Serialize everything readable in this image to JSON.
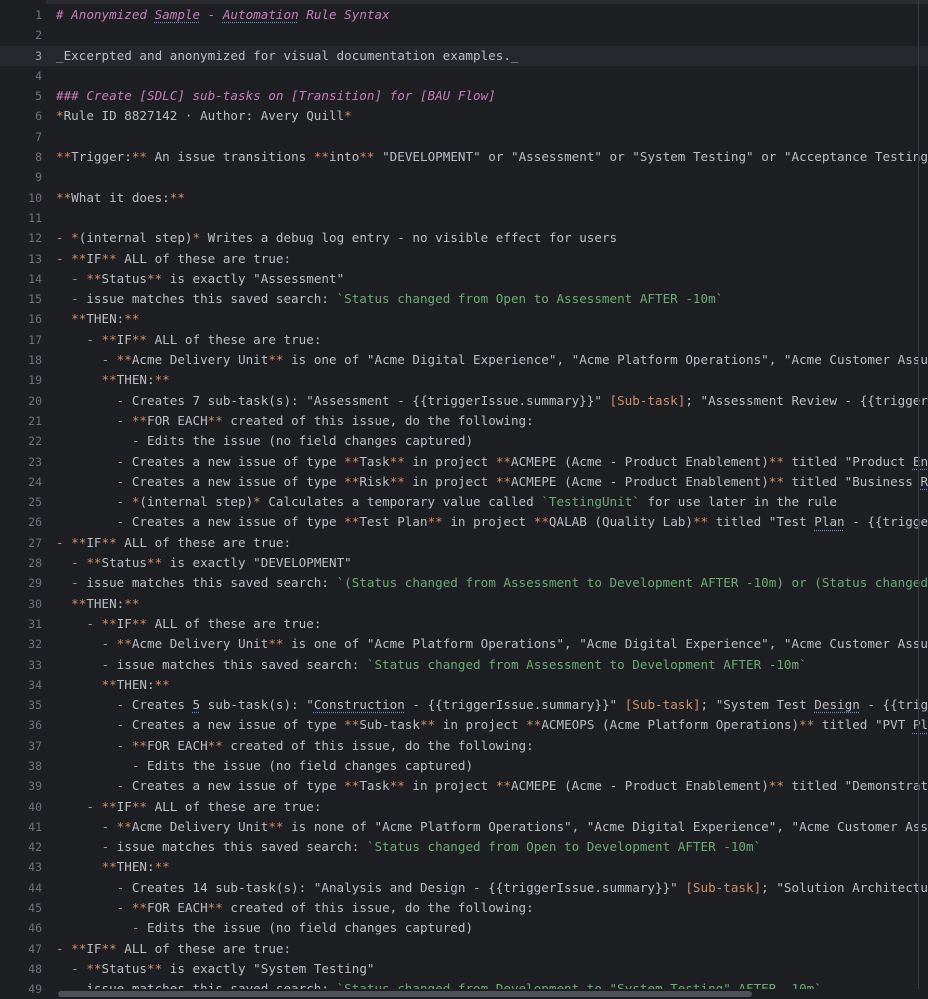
{
  "lines": [
    {
      "n": "1",
      "parts": [
        {
          "t": "# Anonymized ",
          "c": "h"
        },
        {
          "t": "Sample",
          "c": "h typo"
        },
        {
          "t": " - ",
          "c": "h"
        },
        {
          "t": "Automation",
          "c": "h typo"
        },
        {
          "t": " Rule Syntax",
          "c": "h"
        }
      ]
    },
    {
      "n": "2",
      "parts": []
    },
    {
      "n": "3",
      "current": true,
      "parts": [
        {
          "t": "_Excerpted and anonymized for visual documentation examples._"
        }
      ]
    },
    {
      "n": "4",
      "parts": []
    },
    {
      "n": "5",
      "parts": [
        {
          "t": "### Create [SDLC] sub-tasks on [Transition] for [BAU Flow]",
          "c": "h"
        }
      ]
    },
    {
      "n": "6",
      "parts": [
        {
          "t": "*",
          "c": "mk"
        },
        {
          "t": "Rule ID 8827142 · Author: Avery Quill"
        },
        {
          "t": "*",
          "c": "mk"
        }
      ]
    },
    {
      "n": "7",
      "parts": []
    },
    {
      "n": "8",
      "parts": [
        {
          "t": "**",
          "c": "mk"
        },
        {
          "t": "Trigger:"
        },
        {
          "t": "**",
          "c": "mk"
        },
        {
          "t": " An issue transitions "
        },
        {
          "t": "**",
          "c": "mk"
        },
        {
          "t": "into"
        },
        {
          "t": "**",
          "c": "mk"
        },
        {
          "t": " \"DEVELOPMENT\" or \"Assessment\" or \"System Testing\" or \"Acceptance Testing\" or \"R"
        }
      ]
    },
    {
      "n": "9",
      "parts": []
    },
    {
      "n": "10",
      "parts": [
        {
          "t": "**",
          "c": "mk"
        },
        {
          "t": "What it does:"
        },
        {
          "t": "**",
          "c": "mk"
        }
      ]
    },
    {
      "n": "11",
      "parts": []
    },
    {
      "n": "12",
      "parts": [
        {
          "t": "- ",
          "c": "mk"
        },
        {
          "t": "*",
          "c": "mk"
        },
        {
          "t": "(internal step)"
        },
        {
          "t": "*",
          "c": "mk"
        },
        {
          "t": " Writes a debug log entry - no visible effect for users"
        }
      ]
    },
    {
      "n": "13",
      "parts": [
        {
          "t": "- ",
          "c": "mk"
        },
        {
          "t": "**",
          "c": "mk"
        },
        {
          "t": "IF"
        },
        {
          "t": "**",
          "c": "mk"
        },
        {
          "t": " ALL of these are true:"
        }
      ]
    },
    {
      "n": "14",
      "parts": [
        {
          "t": "  - ",
          "c": "mk"
        },
        {
          "t": "**",
          "c": "mk"
        },
        {
          "t": "Status"
        },
        {
          "t": "**",
          "c": "mk"
        },
        {
          "t": " is exactly \"Assessment\""
        }
      ]
    },
    {
      "n": "15",
      "parts": [
        {
          "t": "  - ",
          "c": "mk"
        },
        {
          "t": "issue matches this saved search: "
        },
        {
          "t": "`Status changed from Open to Assessment AFTER -10m`",
          "c": "cd"
        }
      ]
    },
    {
      "n": "16",
      "parts": [
        {
          "t": "  **",
          "c": "mk"
        },
        {
          "t": "THEN:"
        },
        {
          "t": "**",
          "c": "mk"
        }
      ]
    },
    {
      "n": "17",
      "parts": [
        {
          "t": "    - ",
          "c": "mk"
        },
        {
          "t": "**",
          "c": "mk"
        },
        {
          "t": "IF"
        },
        {
          "t": "**",
          "c": "mk"
        },
        {
          "t": " ALL of these are true:"
        }
      ]
    },
    {
      "n": "18",
      "parts": [
        {
          "t": "      - ",
          "c": "mk"
        },
        {
          "t": "**",
          "c": "mk"
        },
        {
          "t": "Acme Delivery Unit"
        },
        {
          "t": "**",
          "c": "mk"
        },
        {
          "t": " is one of \"Acme Digital Experience\", \"Acme Platform Operations\", \"Acme Customer Assurance\""
        }
      ]
    },
    {
      "n": "19",
      "parts": [
        {
          "t": "      **",
          "c": "mk"
        },
        {
          "t": "THEN:"
        },
        {
          "t": "**",
          "c": "mk"
        }
      ]
    },
    {
      "n": "20",
      "parts": [
        {
          "t": "        - ",
          "c": "mk"
        },
        {
          "t": "Creates 7 sub-task(s): \"Assessment - {{triggerIssue.summary}}\" "
        },
        {
          "t": "[Sub-task]",
          "c": "lk"
        },
        {
          "t": "; \"Assessment Review - {{triggerIssue.s"
        }
      ]
    },
    {
      "n": "21",
      "parts": [
        {
          "t": "        - ",
          "c": "mk"
        },
        {
          "t": "**",
          "c": "mk"
        },
        {
          "t": "FOR EACH"
        },
        {
          "t": "**",
          "c": "mk"
        },
        {
          "t": " created of this issue, do the following:"
        }
      ]
    },
    {
      "n": "22",
      "parts": [
        {
          "t": "          - ",
          "c": "mk"
        },
        {
          "t": "Edits the issue (no field changes captured)"
        }
      ]
    },
    {
      "n": "23",
      "parts": [
        {
          "t": "        - ",
          "c": "mk"
        },
        {
          "t": "Creates a new issue of type "
        },
        {
          "t": "**",
          "c": "mk"
        },
        {
          "t": "Task"
        },
        {
          "t": "**",
          "c": "mk"
        },
        {
          "t": " in project "
        },
        {
          "t": "**",
          "c": "mk"
        },
        {
          "t": "ACMEPE (Acme - Product Enablement)"
        },
        {
          "t": "**",
          "c": "mk"
        },
        {
          "t": " titled \"Product "
        },
        {
          "t": "Endorseme",
          "c": "typo"
        }
      ]
    },
    {
      "n": "24",
      "parts": [
        {
          "t": "        - ",
          "c": "mk"
        },
        {
          "t": "Creates a new issue of type "
        },
        {
          "t": "**",
          "c": "mk"
        },
        {
          "t": "Risk"
        },
        {
          "t": "**",
          "c": "mk"
        },
        {
          "t": " in project "
        },
        {
          "t": "**",
          "c": "mk"
        },
        {
          "t": "ACMEPE (Acme - Product Enablement)"
        },
        {
          "t": "**",
          "c": "mk"
        },
        {
          "t": " titled \"Business "
        },
        {
          "t": "Risk - -",
          "c": "typo"
        }
      ]
    },
    {
      "n": "25",
      "parts": [
        {
          "t": "        - ",
          "c": "mk"
        },
        {
          "t": "*",
          "c": "mk"
        },
        {
          "t": "(internal step)"
        },
        {
          "t": "*",
          "c": "mk"
        },
        {
          "t": " Calculates a temporary value called "
        },
        {
          "t": "`TestingUnit`",
          "c": "cd"
        },
        {
          "t": " for use later in the rule"
        }
      ]
    },
    {
      "n": "26",
      "parts": [
        {
          "t": "        - ",
          "c": "mk"
        },
        {
          "t": "Creates a new issue of type "
        },
        {
          "t": "**",
          "c": "mk"
        },
        {
          "t": "Test Plan"
        },
        {
          "t": "**",
          "c": "mk"
        },
        {
          "t": " in project "
        },
        {
          "t": "**",
          "c": "mk"
        },
        {
          "t": "QALAB (Quality Lab)"
        },
        {
          "t": "**",
          "c": "mk"
        },
        {
          "t": " titled \"Test "
        },
        {
          "t": "Plan",
          "c": "typo"
        },
        {
          "t": " - {{triggerIssue."
        }
      ]
    },
    {
      "n": "27",
      "parts": [
        {
          "t": "- ",
          "c": "mk"
        },
        {
          "t": "**",
          "c": "mk"
        },
        {
          "t": "IF"
        },
        {
          "t": "**",
          "c": "mk"
        },
        {
          "t": " ALL of these are true:"
        }
      ]
    },
    {
      "n": "28",
      "parts": [
        {
          "t": "  - ",
          "c": "mk"
        },
        {
          "t": "**",
          "c": "mk"
        },
        {
          "t": "Status"
        },
        {
          "t": "**",
          "c": "mk"
        },
        {
          "t": " is exactly \"DEVELOPMENT\""
        }
      ]
    },
    {
      "n": "29",
      "parts": [
        {
          "t": "  - ",
          "c": "mk"
        },
        {
          "t": "issue matches this saved search: "
        },
        {
          "t": "`(Status changed from Assessment to Development AFTER -10m) or (Status changed from C",
          "c": "cd"
        }
      ]
    },
    {
      "n": "30",
      "parts": [
        {
          "t": "  **",
          "c": "mk"
        },
        {
          "t": "THEN:"
        },
        {
          "t": "**",
          "c": "mk"
        }
      ]
    },
    {
      "n": "31",
      "parts": [
        {
          "t": "    - ",
          "c": "mk"
        },
        {
          "t": "**",
          "c": "mk"
        },
        {
          "t": "IF"
        },
        {
          "t": "**",
          "c": "mk"
        },
        {
          "t": " ALL of these are true:"
        }
      ]
    },
    {
      "n": "32",
      "parts": [
        {
          "t": "      - ",
          "c": "mk"
        },
        {
          "t": "**",
          "c": "mk"
        },
        {
          "t": "Acme Delivery Unit"
        },
        {
          "t": "**",
          "c": "mk"
        },
        {
          "t": " is one of \"Acme Platform Operations\", \"Acme Digital Experience\", \"Acme Customer Assurance\""
        }
      ]
    },
    {
      "n": "33",
      "parts": [
        {
          "t": "      - ",
          "c": "mk"
        },
        {
          "t": "issue matches this saved search: "
        },
        {
          "t": "`Status changed from Assessment to Development AFTER -10m`",
          "c": "cd"
        }
      ]
    },
    {
      "n": "34",
      "parts": [
        {
          "t": "      **",
          "c": "mk"
        },
        {
          "t": "THEN:"
        },
        {
          "t": "**",
          "c": "mk"
        }
      ]
    },
    {
      "n": "35",
      "parts": [
        {
          "t": "        - ",
          "c": "mk"
        },
        {
          "t": "Creates "
        },
        {
          "t": "5",
          "c": "typo"
        },
        {
          "t": " sub-task(s): \""
        },
        {
          "t": "Construction",
          "c": "typo"
        },
        {
          "t": " - {{triggerIssue.summary}}\" "
        },
        {
          "t": "[Sub-task]",
          "c": "lk"
        },
        {
          "t": "; \"System Test "
        },
        {
          "t": "Design",
          "c": "typo"
        },
        {
          "t": " - {{triggerIssu"
        }
      ]
    },
    {
      "n": "36",
      "parts": [
        {
          "t": "        - ",
          "c": "mk"
        },
        {
          "t": "Creates a new issue of type "
        },
        {
          "t": "**",
          "c": "mk"
        },
        {
          "t": "Sub-task"
        },
        {
          "t": "**",
          "c": "mk"
        },
        {
          "t": " in project "
        },
        {
          "t": "**",
          "c": "mk"
        },
        {
          "t": "ACMEOPS (Acme Platform Operations)"
        },
        {
          "t": "**",
          "c": "mk"
        },
        {
          "t": " titled \"PVT "
        },
        {
          "t": "Plan",
          "c": "typo"
        },
        {
          "t": "  - -"
        }
      ]
    },
    {
      "n": "37",
      "parts": [
        {
          "t": "        - ",
          "c": "mk"
        },
        {
          "t": "**",
          "c": "mk"
        },
        {
          "t": "FOR EACH"
        },
        {
          "t": "**",
          "c": "mk"
        },
        {
          "t": " created of this issue, do the following:"
        }
      ]
    },
    {
      "n": "38",
      "parts": [
        {
          "t": "          - ",
          "c": "mk"
        },
        {
          "t": "Edits the issue (no field changes captured)"
        }
      ]
    },
    {
      "n": "39",
      "parts": [
        {
          "t": "        - ",
          "c": "mk"
        },
        {
          "t": "Creates a new issue of type "
        },
        {
          "t": "**",
          "c": "mk"
        },
        {
          "t": "Task"
        },
        {
          "t": "**",
          "c": "mk"
        },
        {
          "t": " in project "
        },
        {
          "t": "**",
          "c": "mk"
        },
        {
          "t": "ACMEPE (Acme - Product Enablement)"
        },
        {
          "t": "**",
          "c": "mk"
        },
        {
          "t": " titled \"Demonstration/Wal"
        }
      ]
    },
    {
      "n": "40",
      "parts": [
        {
          "t": "    - ",
          "c": "mk"
        },
        {
          "t": "**",
          "c": "mk"
        },
        {
          "t": "IF"
        },
        {
          "t": "**",
          "c": "mk"
        },
        {
          "t": " ALL of these are true:"
        }
      ]
    },
    {
      "n": "41",
      "parts": [
        {
          "t": "      - ",
          "c": "mk"
        },
        {
          "t": "**",
          "c": "mk"
        },
        {
          "t": "Acme Delivery Unit"
        },
        {
          "t": "**",
          "c": "mk"
        },
        {
          "t": " is none of \"Acme Platform Operations\", \"Acme Digital Experience\", \"Acme Customer Assurance\""
        }
      ]
    },
    {
      "n": "42",
      "parts": [
        {
          "t": "      - ",
          "c": "mk"
        },
        {
          "t": "issue matches this saved search: "
        },
        {
          "t": "`Status changed from Open to Development AFTER -10m`",
          "c": "cd"
        }
      ]
    },
    {
      "n": "43",
      "parts": [
        {
          "t": "      **",
          "c": "mk"
        },
        {
          "t": "THEN:"
        },
        {
          "t": "**",
          "c": "mk"
        }
      ]
    },
    {
      "n": "44",
      "parts": [
        {
          "t": "        - ",
          "c": "mk"
        },
        {
          "t": "Creates 14 sub-task(s): \"Analysis and Design - {{triggerIssue.summary}}\" "
        },
        {
          "t": "[Sub-task]",
          "c": "lk"
        },
        {
          "t": "; \"Solution Architecture/Arch"
        }
      ]
    },
    {
      "n": "45",
      "parts": [
        {
          "t": "        - ",
          "c": "mk"
        },
        {
          "t": "**",
          "c": "mk"
        },
        {
          "t": "FOR EACH"
        },
        {
          "t": "**",
          "c": "mk"
        },
        {
          "t": " created of this issue, do the following:"
        }
      ]
    },
    {
      "n": "46",
      "parts": [
        {
          "t": "          - ",
          "c": "mk"
        },
        {
          "t": "Edits the issue (no field changes captured)"
        }
      ]
    },
    {
      "n": "47",
      "parts": [
        {
          "t": "- ",
          "c": "mk"
        },
        {
          "t": "**",
          "c": "mk"
        },
        {
          "t": "IF"
        },
        {
          "t": "**",
          "c": "mk"
        },
        {
          "t": " ALL of these are true:"
        }
      ]
    },
    {
      "n": "48",
      "parts": [
        {
          "t": "  - ",
          "c": "mk"
        },
        {
          "t": "**",
          "c": "mk"
        },
        {
          "t": "Status"
        },
        {
          "t": "**",
          "c": "mk"
        },
        {
          "t": " is exactly \"System Testing\""
        }
      ]
    },
    {
      "n": "49",
      "parts": [
        {
          "t": "  - ",
          "c": "mk"
        },
        {
          "t": "issue matches this saved search: "
        },
        {
          "t": "`Status changed from Development to \"System Testing\" AFTER -10m`",
          "c": "cd"
        }
      ]
    }
  ],
  "colors": {
    "background": "#1e1f22",
    "text": "#bcbec4",
    "heading": "#c77dbb",
    "markup": "#cf8e6d",
    "code": "#6aab73",
    "line_number": "#6f737a"
  }
}
